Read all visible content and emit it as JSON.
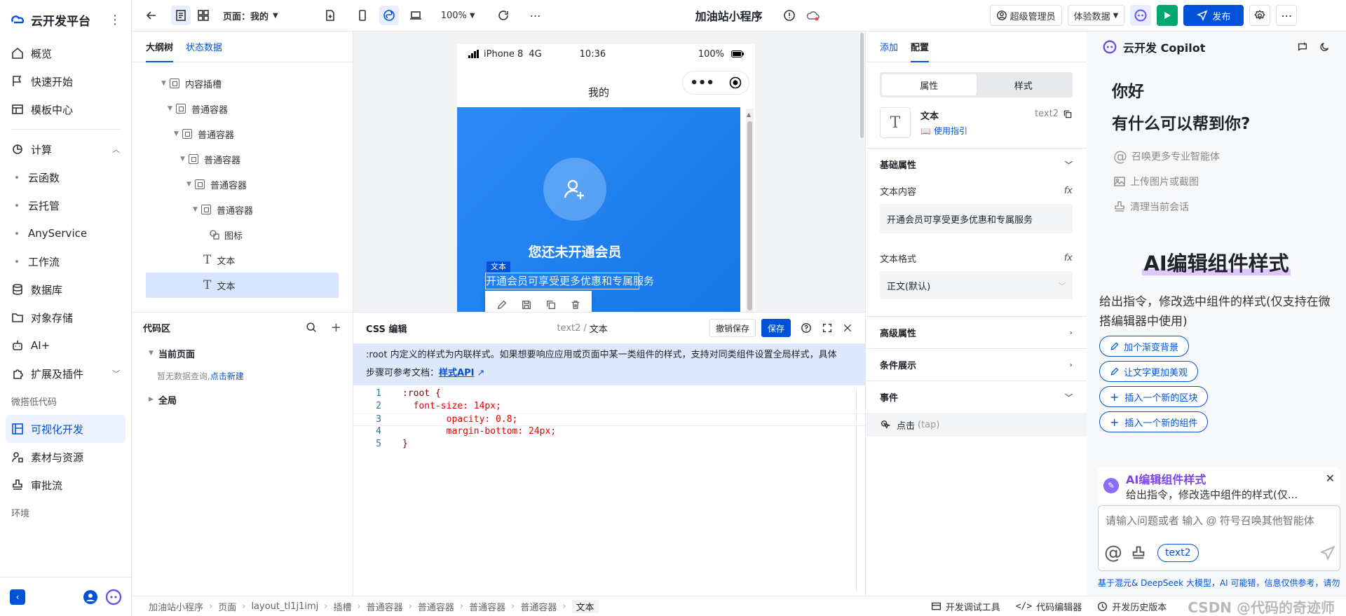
{
  "brand": {
    "name": "云开发平台"
  },
  "nav": {
    "overview": "概览",
    "quickstart": "快速开始",
    "templates": "模板中心",
    "compute": "计算",
    "functions": "云函数",
    "hosting": "云托管",
    "anyservice": "AnyService",
    "workflow": "工作流",
    "database": "数据库",
    "storage": "对象存储",
    "ai": "AI+",
    "extensions": "扩展及插件",
    "lowcode_group": "微搭低代码",
    "visual_dev": "可视化开发",
    "assets": "素材与资源",
    "approval": "审批流",
    "env_group": "环境"
  },
  "toolbar": {
    "page_label": "页面：我的",
    "zoom": "100%",
    "app_name": "加油站小程序",
    "role": "超级管理员",
    "data_mode": "体验数据",
    "publish": "发布"
  },
  "outline": {
    "tabs": [
      "大纲树",
      "状态数据"
    ],
    "items": [
      {
        "label": "内容插槽"
      },
      {
        "label": "普通容器"
      },
      {
        "label": "普通容器"
      },
      {
        "label": "普通容器"
      },
      {
        "label": "普通容器"
      },
      {
        "label": "普通容器"
      },
      {
        "label": "图标"
      },
      {
        "label": "文本"
      },
      {
        "label": "文本"
      }
    ]
  },
  "codearea": {
    "title": "代码区",
    "current_page": "当前页面",
    "empty_text": "暂无数据查询,",
    "create_link": "点击新建",
    "global": "全局"
  },
  "phone": {
    "carrier": "iPhone 8",
    "network": "4G",
    "time": "10:36",
    "battery": "100%",
    "page_title": "我的",
    "member_title": "您还未开通会员",
    "selected_tag": "文本",
    "member_desc": "开通会员可享受更多优惠和专属服务"
  },
  "csseditor": {
    "title": "CSS 编辑",
    "path_id": "text2",
    "path_sep": "/",
    "path_name": "文本",
    "undo_save": "撤销保存",
    "save": "保存",
    "notice_line1": ":root 内定义的样式为内联样式。如果想要响应应用或页面中某一类组件的样式，支持对同类组件设置全局样式，具体",
    "notice_line2": "步骤可参考文档：",
    "notice_link": "样式API",
    "code": [
      {
        "n": "1",
        "t": ":root {"
      },
      {
        "n": "2",
        "t": "  font-size: 14px;"
      },
      {
        "n": "3",
        "t": "        opacity: 0.8;"
      },
      {
        "n": "4",
        "t": "        margin-bottom: 24px;"
      },
      {
        "n": "5",
        "t": "}"
      }
    ]
  },
  "config": {
    "tabs": [
      "添加",
      "配置"
    ],
    "seg": [
      "属性",
      "样式"
    ],
    "component_name": "文本",
    "component_id": "text2",
    "guide": "使用指引",
    "basic": "基础属性",
    "content_label": "文本内容",
    "content_value": "开通会员可享受更多优惠和专属服务",
    "format_label": "文本格式",
    "format_value": "正文(默认)",
    "advanced": "高级属性",
    "conditional": "条件展示",
    "events": "事件",
    "event_item": "点击",
    "event_code": "(tap)",
    "fx": "fx"
  },
  "copilot": {
    "title": "云开发 Copilot",
    "hello": "你好",
    "help": "有什么可以帮到你?",
    "summon": "召唤更多专业智能体",
    "upload": "上传图片或截图",
    "clear": "清理当前会话",
    "feature_title": "AI编辑组件样式",
    "feature_desc": "给出指令，修改选中组件的样式(仅支持在微搭编辑器中使用)",
    "chips": [
      "加个渐变背景",
      "让文字更加美观",
      "插入一个新的区块",
      "插入一个新的组件"
    ],
    "card_title": "AI编辑组件样式",
    "card_desc": "给出指令，修改选中组件的样式(仅...",
    "input_placeholder": "请输入问题或者 输入 @ 符号召唤其他智能体",
    "input_tag": "text2",
    "footer": "基于混元& DeepSeek 大模型，AI 可能错，信息仅供参考，请勿传播"
  },
  "statusbar": {
    "crumbs": [
      "加油站小程序",
      "页面",
      "layout_tl1j1imj",
      "插槽",
      "普通容器",
      "普通容器",
      "普通容器",
      "普通容器",
      "文本"
    ],
    "devtools": "开发调试工具",
    "code_editor": "代码编辑器",
    "history": "开发历史版本",
    "watermark": "CSDN @代码的奇迹师"
  }
}
